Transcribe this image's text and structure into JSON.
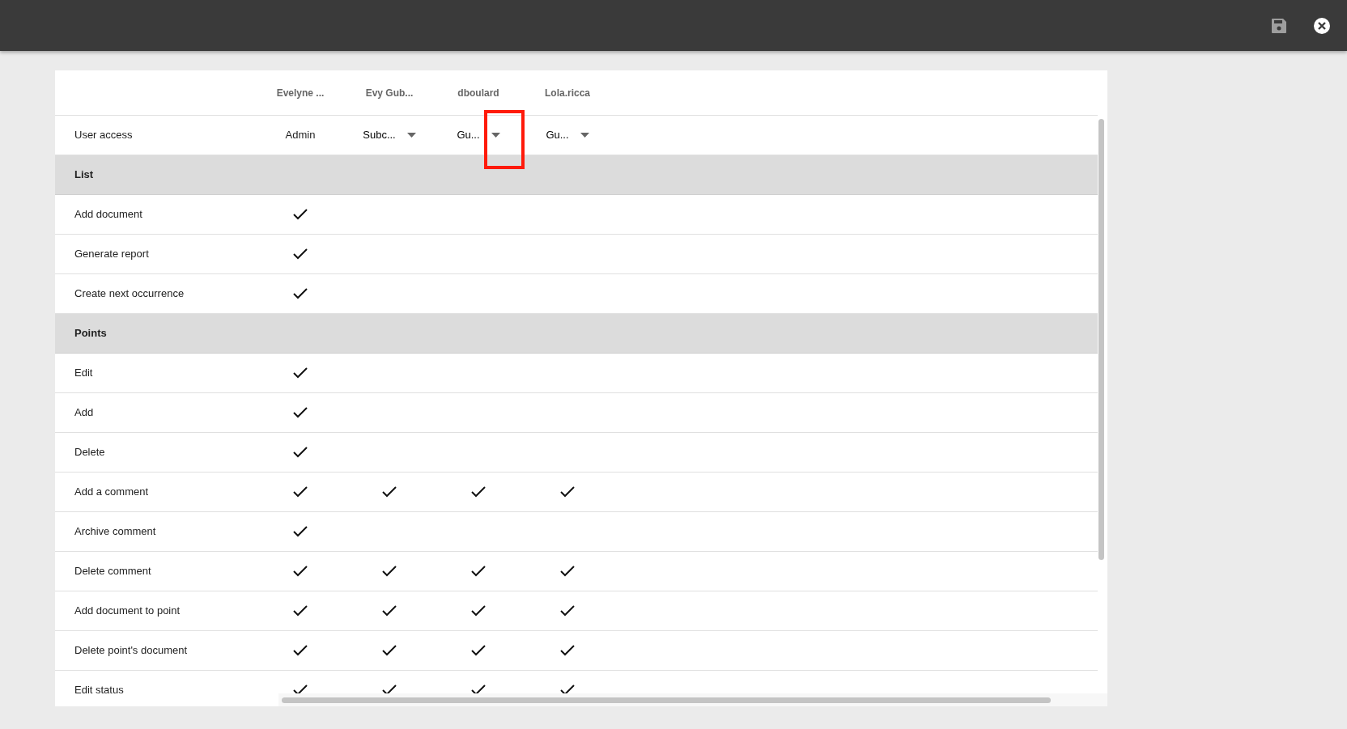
{
  "toolbar": {
    "buttons": [
      {
        "kind": "save"
      },
      {
        "kind": "close"
      }
    ]
  },
  "users": [
    "Evelyne ...",
    "Evy Gub...",
    "dboulard",
    "Lola.ricca"
  ],
  "user_access": {
    "label": "User access",
    "values": [
      {
        "kind": "text",
        "value": "Admin",
        "highlighted": false
      },
      {
        "kind": "dropdown",
        "value": "Subc...",
        "highlighted": false
      },
      {
        "kind": "dropdown",
        "value": "Gu...",
        "highlighted": true
      },
      {
        "kind": "dropdown",
        "value": "Gu...",
        "highlighted": false
      }
    ]
  },
  "sections": [
    {
      "title": "List",
      "rows": [
        {
          "label": "Add document",
          "checked": [
            true,
            false,
            false,
            false
          ]
        },
        {
          "label": "Generate report",
          "checked": [
            true,
            false,
            false,
            false
          ]
        },
        {
          "label": "Create next occurrence",
          "checked": [
            true,
            false,
            false,
            false
          ]
        }
      ]
    },
    {
      "title": "Points",
      "rows": [
        {
          "label": "Edit",
          "checked": [
            true,
            false,
            false,
            false
          ]
        },
        {
          "label": "Add",
          "checked": [
            true,
            false,
            false,
            false
          ]
        },
        {
          "label": "Delete",
          "checked": [
            true,
            false,
            false,
            false
          ]
        },
        {
          "label": "Add a comment",
          "checked": [
            true,
            true,
            true,
            true
          ]
        },
        {
          "label": "Archive comment",
          "checked": [
            true,
            false,
            false,
            false
          ]
        },
        {
          "label": "Delete comment",
          "checked": [
            true,
            true,
            true,
            true
          ]
        },
        {
          "label": "Add document to point",
          "checked": [
            true,
            true,
            true,
            true
          ]
        },
        {
          "label": "Delete point's document",
          "checked": [
            true,
            true,
            true,
            true
          ]
        },
        {
          "label": "Edit status",
          "checked": [
            true,
            true,
            true,
            true
          ]
        }
      ]
    }
  ]
}
